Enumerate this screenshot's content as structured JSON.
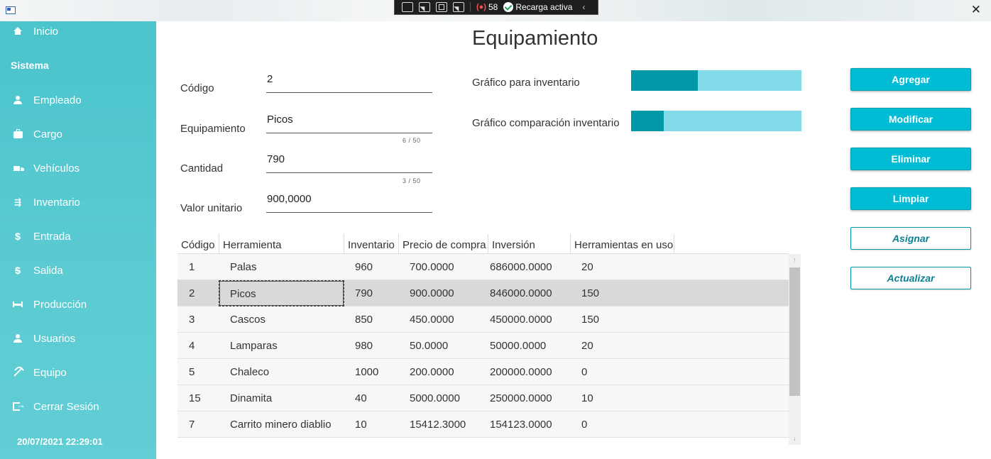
{
  "window": {
    "close_symbol": "✕",
    "icon": "app-window-icon"
  },
  "debug_toolbar": {
    "error_count": "58",
    "hot_reload_label": "Recarga activa",
    "collapse_symbol": "‹"
  },
  "sidebar": {
    "items": [
      {
        "label": "Inicio",
        "icon": "home-icon"
      },
      {
        "label": "Empleado",
        "icon": "user-icon"
      },
      {
        "label": "Cargo",
        "icon": "briefcase-icon"
      },
      {
        "label": "Vehículos",
        "icon": "truck-icon"
      },
      {
        "label": "Inventario",
        "icon": "inventory-icon"
      },
      {
        "label": "Entrada",
        "icon": "dollar-icon"
      },
      {
        "label": "Salida",
        "icon": "money-off-icon"
      },
      {
        "label": "Producción",
        "icon": "bed-icon"
      },
      {
        "label": "Usuarios",
        "icon": "user-icon"
      },
      {
        "label": "Equipo",
        "icon": "pickaxe-icon"
      },
      {
        "label": "Cerrar Sesión",
        "icon": "logout-icon"
      }
    ],
    "section_label": "Sistema",
    "datetime": "20/07/2021 22:29:01"
  },
  "page": {
    "title": "Equipamiento"
  },
  "form": {
    "codigo_label": "Código",
    "codigo_value": "2",
    "equipamiento_label": "Equipamiento",
    "equipamiento_value": "Picos",
    "equipamiento_counter": "6 / 50",
    "cantidad_label": "Cantidad",
    "cantidad_value": "790",
    "cantidad_counter": "3 / 50",
    "valor_label": "Valor unitario",
    "valor_value": "900,0000"
  },
  "charts": {
    "inventario_label": "Gráfico para inventario",
    "inventario_fraction": 0.39,
    "comparacion_label": "Gráfico comparación inventario",
    "comparacion_fraction": 0.19,
    "fill_color": "#0097a7",
    "track_color": "#82dbe9"
  },
  "actions": {
    "agregar": "Agregar",
    "modificar": "Modificar",
    "eliminar": "Eliminar",
    "limpiar": "Limpiar",
    "asignar": "Asignar",
    "actualizar": "Actualizar"
  },
  "table": {
    "headers": [
      "Código",
      "Herramienta",
      "Inventario",
      "Precio de compra",
      "Inversión",
      "Herramientas en uso"
    ],
    "rows": [
      [
        "1",
        "Palas",
        "960",
        "700.0000",
        "686000.0000",
        "20"
      ],
      [
        "2",
        "Picos",
        "790",
        "900.0000",
        "846000.0000",
        "150"
      ],
      [
        "3",
        "Cascos",
        "850",
        "450.0000",
        "450000.0000",
        "150"
      ],
      [
        "4",
        "Lamparas",
        "980",
        "50.0000",
        "50000.0000",
        "20"
      ],
      [
        "5",
        "Chaleco",
        "1000",
        "200.0000",
        "200000.0000",
        "0"
      ],
      [
        "15",
        "Dinamita",
        "40",
        "5000.0000",
        "250000.0000",
        "10"
      ],
      [
        "7",
        "Carrito minero diablio",
        "10",
        "15412.3000",
        "154123.0000",
        "0"
      ]
    ],
    "selected_row": 1,
    "scroll_up": "↑",
    "scroll_down": "↓"
  },
  "colors": {
    "sidebar": "#4bc4cc",
    "accent": "#00bcd4",
    "accent_dark": "#0097a7"
  }
}
